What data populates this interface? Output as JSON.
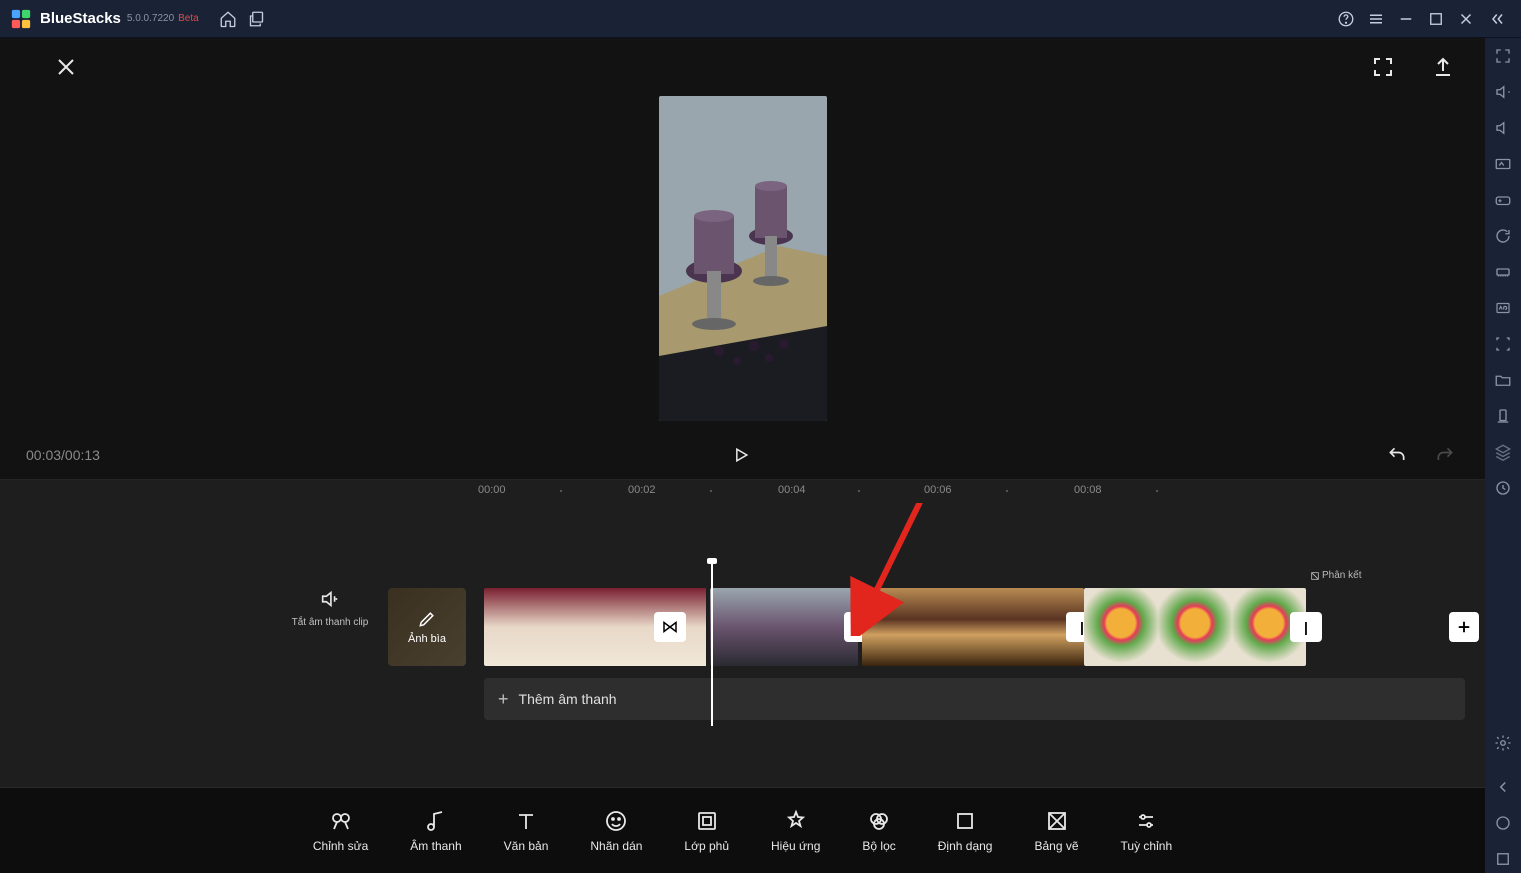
{
  "titlebar": {
    "brand": "BlueStacks",
    "version": "5.0.0.7220",
    "beta": "Beta"
  },
  "playback": {
    "timecode": "00:03/00:13"
  },
  "ruler": {
    "labels": [
      "00:00",
      "00:02",
      "00:04",
      "00:06",
      "00:08"
    ]
  },
  "clipControls": {
    "muteLabel": "Tắt âm thanh clip"
  },
  "cover": {
    "label": "Ảnh bìa"
  },
  "timeline": {
    "audioAddLabel": "Thêm âm thanh",
    "phanketLabel": "Phân kết"
  },
  "tools": [
    {
      "label": "Chỉnh sửa"
    },
    {
      "label": "Âm thanh"
    },
    {
      "label": "Văn bản"
    },
    {
      "label": "Nhãn dán"
    },
    {
      "label": "Lớp phủ"
    },
    {
      "label": "Hiệu ứng"
    },
    {
      "label": "Bộ lọc"
    },
    {
      "label": "Định dạng"
    },
    {
      "label": "Bảng vẽ"
    },
    {
      "label": "Tuỳ chỉnh"
    }
  ]
}
